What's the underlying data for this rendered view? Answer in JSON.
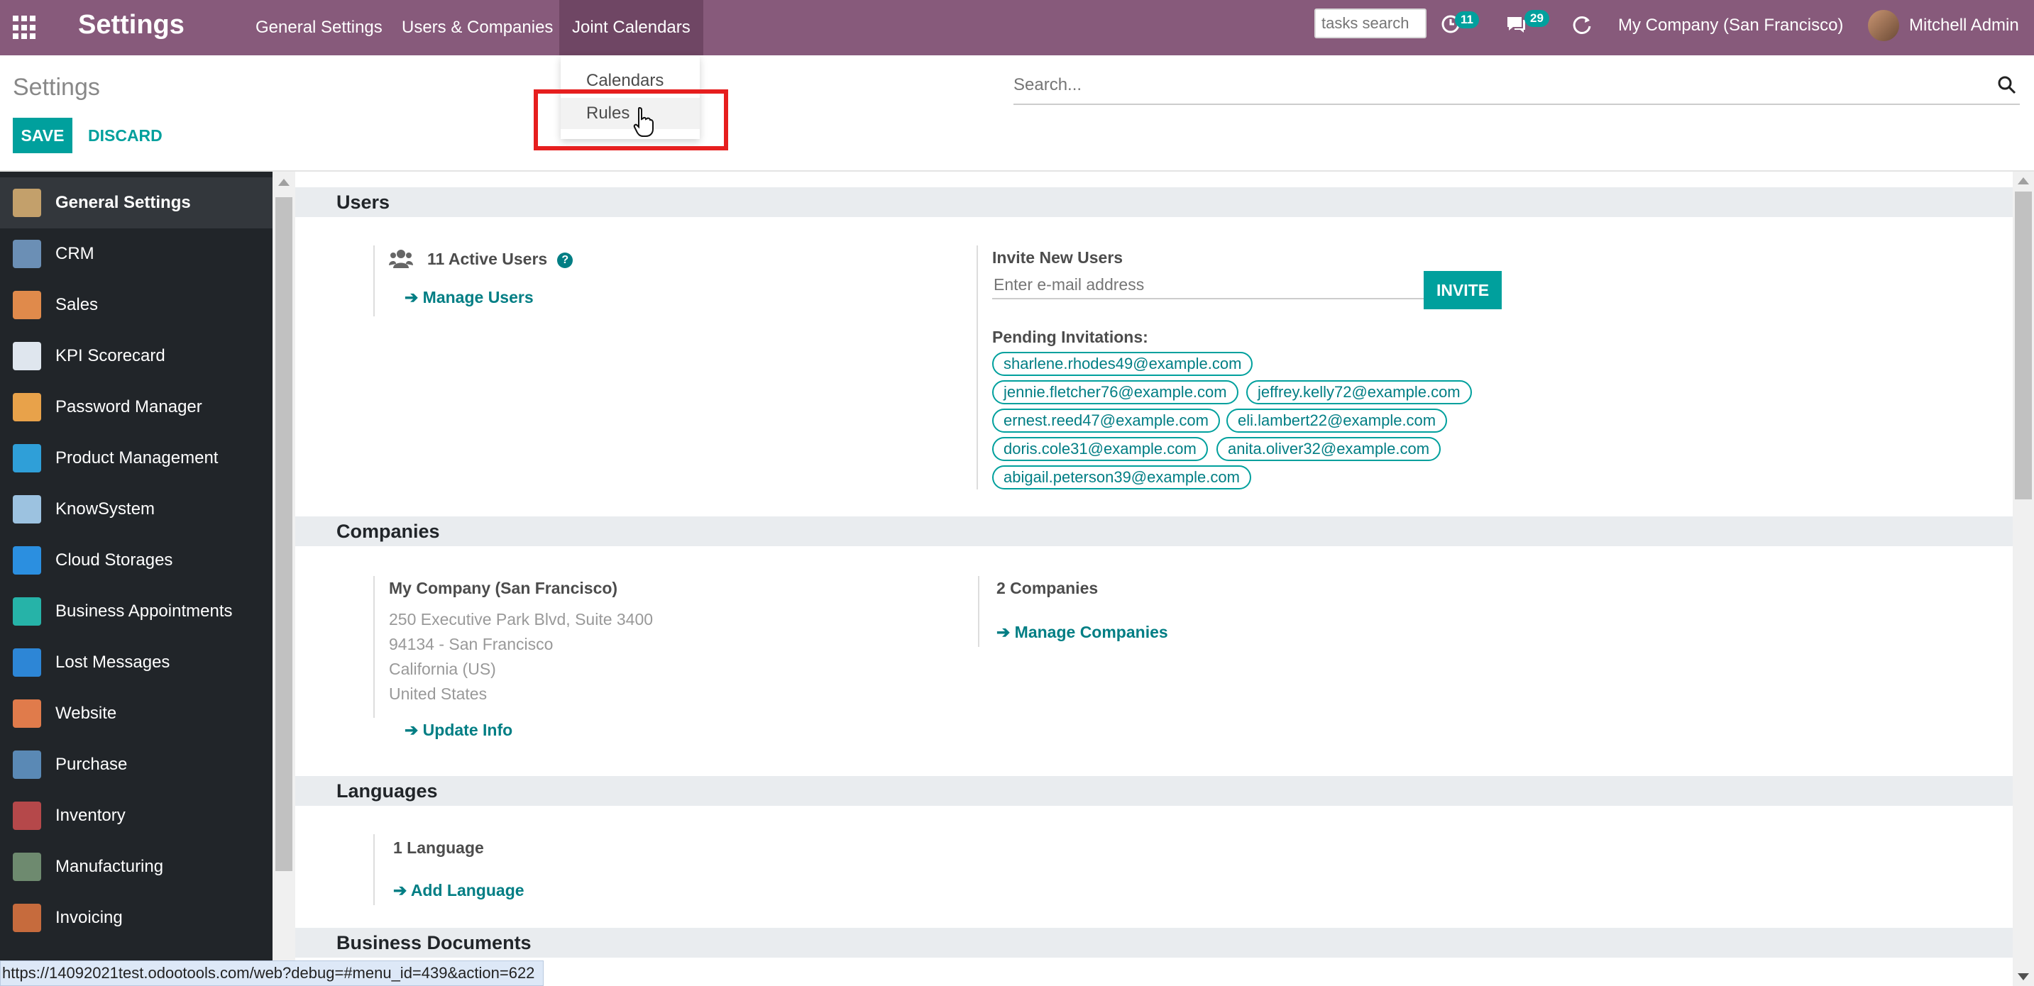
{
  "navbar": {
    "brand": "Settings",
    "menus": [
      "General Settings",
      "Users & Companies",
      "Joint Calendars"
    ],
    "tasks_search_placeholder": "tasks search",
    "activity_count": "11",
    "messages_count": "29",
    "company": "My Company (San Francisco)",
    "user": "Mitchell Admin"
  },
  "dropdown": {
    "items": [
      "Calendars",
      "Rules"
    ]
  },
  "control_panel": {
    "breadcrumb": "Settings",
    "save": "SAVE",
    "discard": "DISCARD",
    "search_placeholder": "Search..."
  },
  "sidebar": {
    "items": [
      {
        "label": "General Settings",
        "color": "#c3a06b"
      },
      {
        "label": "CRM",
        "color": "#6b8fb5"
      },
      {
        "label": "Sales",
        "color": "#e08a4b"
      },
      {
        "label": "KPI Scorecard",
        "color": "#dfe6ee"
      },
      {
        "label": "Password Manager",
        "color": "#e8a24a"
      },
      {
        "label": "Product Management",
        "color": "#2f9fd8"
      },
      {
        "label": "KnowSystem",
        "color": "#9cc2e0"
      },
      {
        "label": "Cloud Storages",
        "color": "#2b8fe0"
      },
      {
        "label": "Business Appointments",
        "color": "#26b3a8"
      },
      {
        "label": "Lost Messages",
        "color": "#2d86d6"
      },
      {
        "label": "Website",
        "color": "#e07b4b"
      },
      {
        "label": "Purchase",
        "color": "#5a89b5"
      },
      {
        "label": "Inventory",
        "color": "#b5484a"
      },
      {
        "label": "Manufacturing",
        "color": "#6e8a6f"
      },
      {
        "label": "Invoicing",
        "color": "#c66b3d"
      }
    ]
  },
  "users": {
    "header": "Users",
    "active_users": "11 Active Users",
    "manage_users": "Manage Users",
    "invite_label": "Invite New Users",
    "email_placeholder": "Enter e-mail address",
    "invite_button": "INVITE",
    "pending_label": "Pending Invitations:",
    "invitations": [
      "sharlene.rhodes49@example.com",
      "jennie.fletcher76@example.com",
      "jeffrey.kelly72@example.com",
      "ernest.reed47@example.com",
      "eli.lambert22@example.com",
      "doris.cole31@example.com",
      "anita.oliver32@example.com",
      "abigail.peterson39@example.com"
    ]
  },
  "companies": {
    "header": "Companies",
    "name": "My Company (San Francisco)",
    "address": [
      "250 Executive Park Blvd, Suite 3400",
      "94134 - San Francisco",
      "California (US)",
      "United States"
    ],
    "update_info": "Update Info",
    "count": "2 Companies",
    "manage": "Manage Companies"
  },
  "languages": {
    "header": "Languages",
    "count": "1 Language",
    "add": "Add Language"
  },
  "business_documents": {
    "header": "Business Documents"
  },
  "status_url": "https://14092021test.odootools.com/web?debug=#menu_id=439&action=622"
}
